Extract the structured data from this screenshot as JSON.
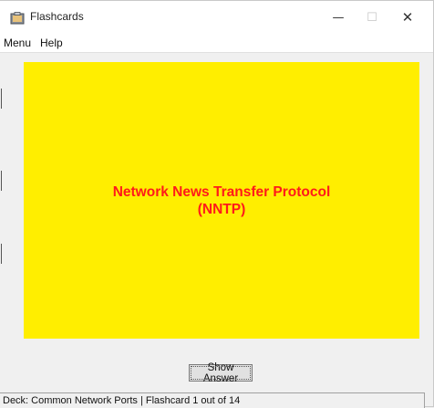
{
  "window": {
    "title": "Flashcards",
    "icon": "clipboard-icon",
    "controls": {
      "minimize": "—",
      "maximize": "☐",
      "close": "✕"
    }
  },
  "menu": {
    "items": [
      {
        "label": "Menu"
      },
      {
        "label": "Help"
      }
    ]
  },
  "card": {
    "text": "Network News Transfer Protocol\n(NNTP)",
    "background_color": "#ffee00",
    "text_color": "#ff1a1a"
  },
  "show_answer_label": "Show Answer",
  "status": {
    "text": "Deck: Common Network Ports | Flashcard 1 out of 14"
  }
}
